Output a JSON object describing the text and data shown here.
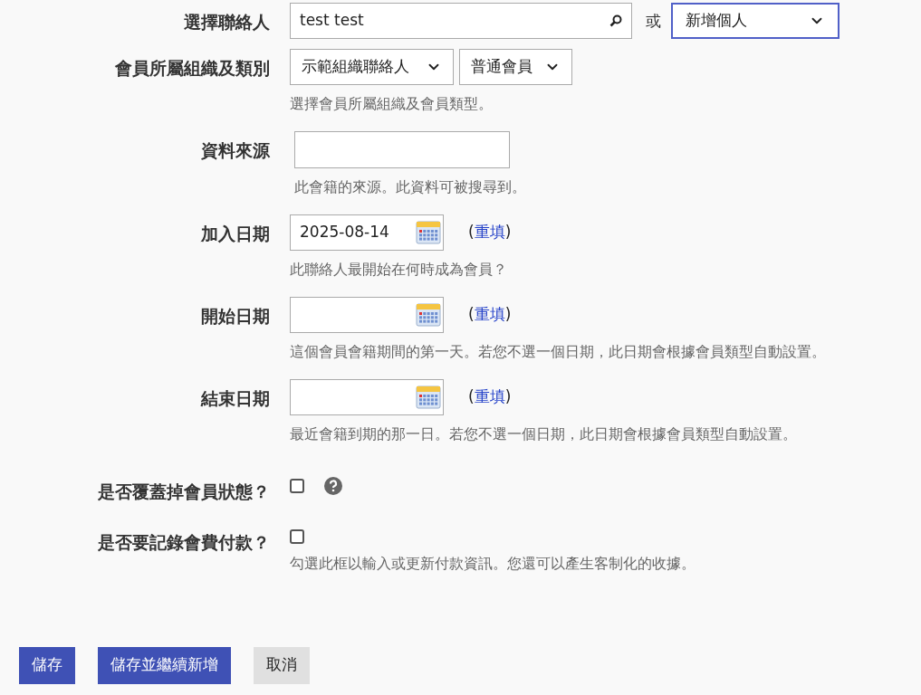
{
  "rows": [
    {
      "kind": "contact",
      "label": "選擇聯絡人",
      "value": "test test",
      "or": "或",
      "option": "新增個人"
    },
    {
      "kind": "selects",
      "label": "會員所屬組織及類別",
      "options": [
        "示範組織聯絡人",
        "普通會員"
      ],
      "help": "選擇會員所屬組織及會員類型。"
    },
    {
      "kind": "text",
      "label": "資料來源",
      "help": "此會籍的來源。此資料可被搜尋到。"
    },
    {
      "kind": "date",
      "label": "加入日期",
      "value": "2025-08-14",
      "reset": {
        "open": "(",
        "link": "重填",
        "close": ")"
      },
      "help": "此聯絡人最開始在何時成為會員？"
    },
    {
      "kind": "date",
      "label": "開始日期",
      "reset": {
        "open": "(",
        "link": "重填",
        "close": ")"
      },
      "help": "這個會員會籍期間的第一天。若您不選一個日期，此日期會根據會員類型自動設置。"
    },
    {
      "kind": "date",
      "label": "結束日期",
      "reset": {
        "open": "(",
        "link": "重填",
        "close": ")"
      },
      "help": "最近會籍到期的那一日。若您不選一個日期，此日期會根據會員類型自動設置。"
    },
    {
      "kind": "checkbox",
      "label": "是否覆蓋掉會員狀態？",
      "checked": false,
      "help_icon": true
    },
    {
      "kind": "checkbox",
      "label": "是否要記錄會費付款？",
      "checked": false,
      "help": "勾選此框以輸入或更新付款資訊。您還可以產生客制化的收據。"
    }
  ],
  "buttons": [
    {
      "label": "儲存",
      "kind": "primary"
    },
    {
      "label": "儲存並繼續新增",
      "kind": "primary"
    },
    {
      "label": "取消",
      "kind": "secondary"
    }
  ]
}
